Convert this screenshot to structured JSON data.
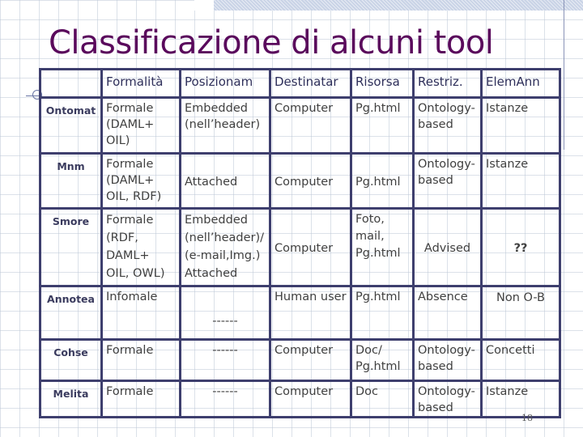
{
  "slide": {
    "title": "Classificazione di alcuni tool",
    "page_number": "18"
  },
  "table": {
    "headers": [
      "",
      "Formalità",
      "Posizionam",
      "Destinatar",
      "Risorsa",
      "Restriz.",
      "ElemAnn"
    ],
    "rows": [
      {
        "tool": "Ontomat",
        "formalita": "Formale (DAML+ OIL)",
        "posizionam": "Embedded (nell’header)",
        "destinatar": "Computer",
        "risorsa": "Pg.html",
        "restriz": "Ontology-based",
        "elemann": "Istanze"
      },
      {
        "tool": "Mnm",
        "formalita": "Formale (DAML+ OIL, RDF)",
        "posizionam": "Attached",
        "destinatar": "Computer",
        "risorsa": "Pg.html",
        "restriz": "Ontology-based",
        "elemann": "Istanze"
      },
      {
        "tool": "Smore",
        "formalita": "Formale (RDF, DAML+ OIL, OWL)",
        "posizionam": "Embedded (nell’header)/ (e-mail,Img.) Attached",
        "destinatar": "Computer",
        "risorsa": "Foto, mail, Pg.html",
        "restriz": "Advised",
        "elemann": "??"
      },
      {
        "tool": "Annotea",
        "formalita": "Infomale",
        "posizionam": "------",
        "destinatar": "Human user",
        "risorsa": "Pg.html",
        "restriz": "Absence",
        "elemann": "Non O-B"
      },
      {
        "tool": "Cohse",
        "formalita": "Formale",
        "posizionam": "------",
        "destinatar": "Computer",
        "risorsa": "Doc/ Pg.html",
        "restriz": "Ontology-based",
        "elemann": "Concetti"
      },
      {
        "tool": "Melita",
        "formalita": "Formale",
        "posizionam": "------",
        "destinatar": "Computer",
        "risorsa": "Doc",
        "restriz": "Ontology-based",
        "elemann": "Istanze"
      }
    ]
  }
}
